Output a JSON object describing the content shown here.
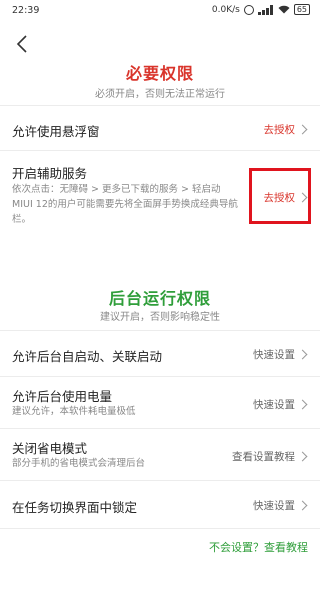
{
  "status_bar": {
    "time": "22:39",
    "network_speed": "0.0K/s",
    "battery": "65"
  },
  "header": {
    "back_icon": "chevron-left-icon"
  },
  "required": {
    "title": "必要权限",
    "subtitle": "必须开启，否则无法正常运行",
    "color": "#d9342b",
    "items": [
      {
        "label": "允许使用悬浮窗",
        "action": "去授权"
      },
      {
        "label": "开启辅助服务",
        "description": "依次点击：无障碍 > 更多已下载的服务 > 轻启动 MIUI 12的用户可能需要先将全面屏手势换成经典导航栏。",
        "action": "去授权"
      }
    ]
  },
  "background": {
    "title": "后台运行权限",
    "subtitle": "建议开启，否则影响稳定性",
    "color": "#2f9e3a",
    "items": [
      {
        "label": "允许后台自启动、关联启动",
        "action": "快速设置"
      },
      {
        "label": "允许后台使用电量",
        "description": "建议允许，本软件耗电量极低",
        "action": "快速设置"
      },
      {
        "label": "关闭省电模式",
        "description": "部分手机的省电模式会清理后台",
        "action": "查看设置教程"
      },
      {
        "label": "在任务切换界面中锁定",
        "action": "快速设置"
      }
    ]
  },
  "help_link": "不会设置？查看教程"
}
